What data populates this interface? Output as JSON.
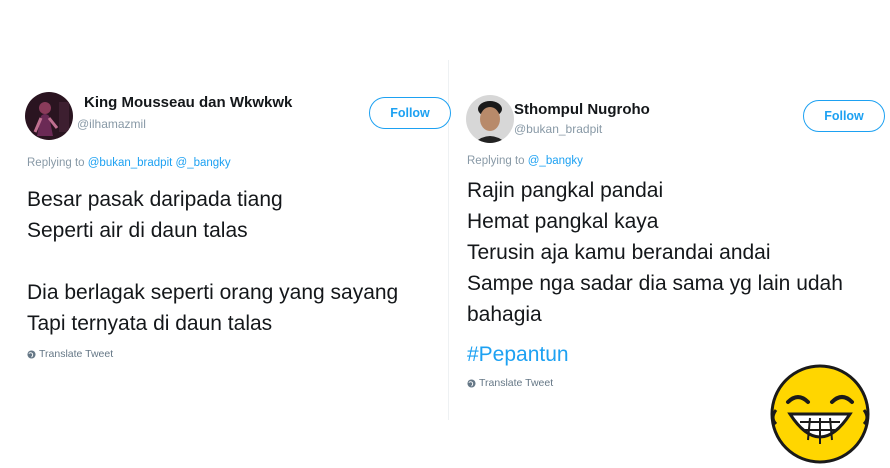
{
  "tweets": [
    {
      "name": "King Mousseau dan Wkwkwk",
      "handle": "@ilhamazmil",
      "follow_label": "Follow",
      "replying_prefix": "Replying to",
      "replying_mentions": [
        "@bukan_bradpit",
        "@_bangky"
      ],
      "lines": [
        "Besar pasak daripada tiang",
        "Seperti air di daun talas",
        "",
        "Dia berlagak seperti orang yang sayang",
        "Tapi ternyata di daun talas"
      ],
      "translate_label": "Translate Tweet"
    },
    {
      "name": "Sthompul Nugroho",
      "handle": "@bukan_bradpit",
      "follow_label": "Follow",
      "replying_prefix": "Replying to",
      "replying_mentions": [
        "@_bangky"
      ],
      "lines": [
        "Rajin pangkal pandai",
        "Hemat pangkal kaya",
        "Terusin aja kamu berandai andai",
        "Sampe nga sadar dia sama yg lain udah",
        "bahagia"
      ],
      "hashtag": "#Pepantun",
      "translate_label": "Translate Tweet"
    }
  ],
  "colors": {
    "accent": "#1da1f2",
    "text": "#14171a",
    "muted": "#8899a6",
    "emoji_face": "#ffd600"
  }
}
